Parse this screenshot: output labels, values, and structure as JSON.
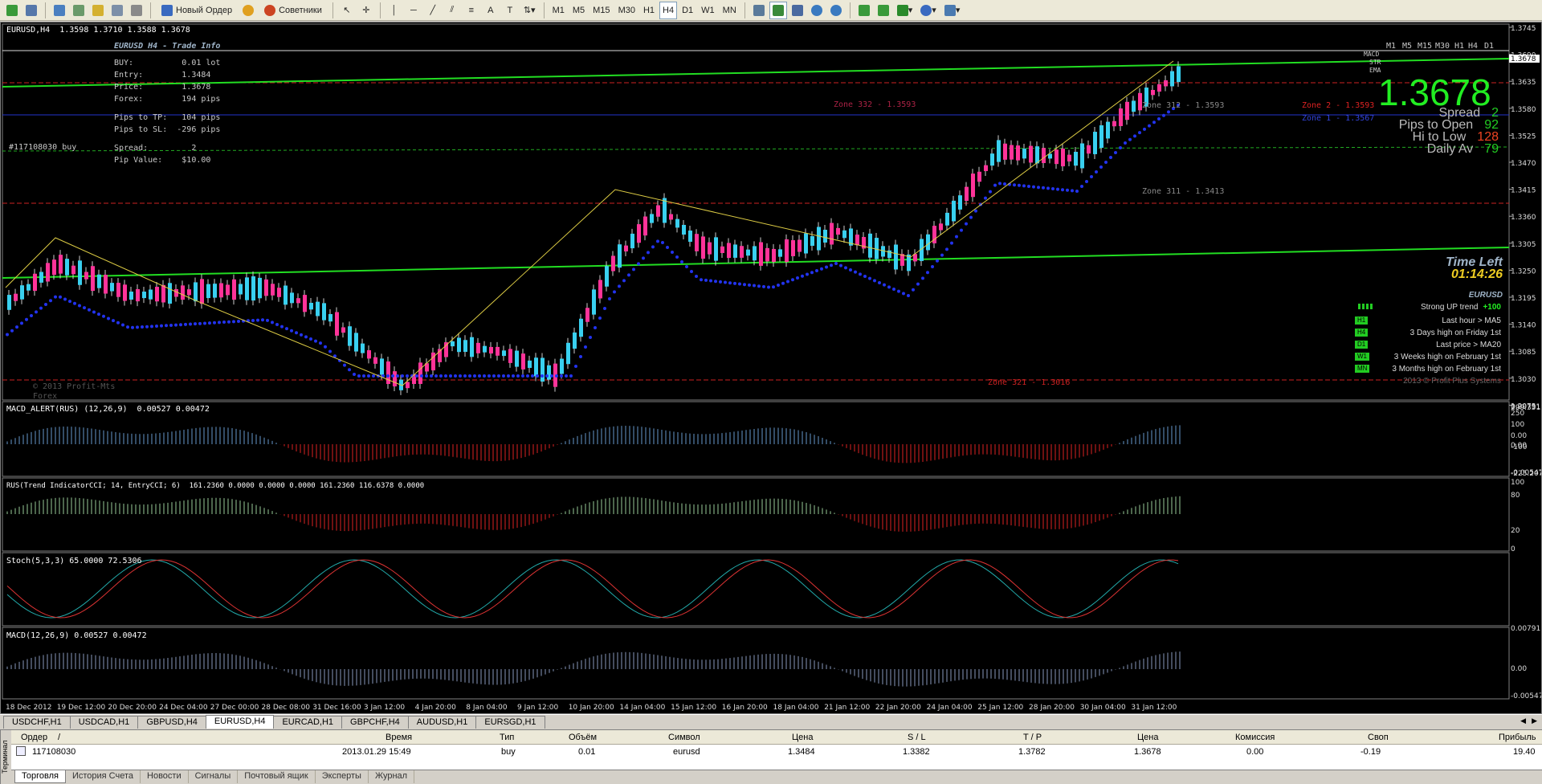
{
  "toolbar": {
    "new_order_label": "Новый Ордер",
    "advisors_label": "Советники",
    "timeframes": [
      "M1",
      "M5",
      "M15",
      "M30",
      "H1",
      "H4",
      "D1",
      "W1",
      "MN"
    ],
    "active_timeframe": "H4"
  },
  "chart": {
    "header": "EURUSD,H4  1.3598 1.3710 1.3588 1.3678",
    "order_label": "#117108030 buy",
    "watermark_1": "© 2013 Profit-Mts",
    "watermark_2": "Forex",
    "trade_info": {
      "title": "EURUSD H4 - Trade Info",
      "buy": "BUY:          0.01 lot",
      "entry": "Entry:        1.3484",
      "price": "Price:        1.3678",
      "forex": "Forex:        194 pips",
      "to_tp": "Pips to TP:   104 pips",
      "to_sl": "Pips to SL:  -296 pips",
      "spread": "Spread:         2",
      "pip_value": "Pip Value:    $10.00"
    },
    "zones": {
      "zone332": "Zone 332 - 1.3593",
      "zone312": "Zone 312 - 1.3593",
      "zone2": "Zone 2 - 1.3593",
      "zone1": "Zone 1 - 1.3567",
      "zone311": "Zone 311 - 1.3413",
      "zone321": "Zone 321 - 1.3016"
    },
    "price_axis": [
      "1.3745",
      "1.3690",
      "1.3635",
      "1.3580",
      "1.3525",
      "1.3470",
      "1.3415",
      "1.3360",
      "1.3305",
      "1.3250",
      "1.3195",
      "1.3140",
      "1.3085",
      "1.3030",
      "1.2975"
    ],
    "current_price_tag": "1.3678",
    "time_axis": [
      "18 Dec 2012",
      "19 Dec 12:00",
      "20 Dec 20:00",
      "24 Dec 04:00",
      "27 Dec 00:00",
      "28 Dec 08:00",
      "31 Dec 16:00",
      "3 Jan 12:00",
      "4 Jan 20:00",
      "8 Jan 04:00",
      "9 Jan 12:00",
      "10 Jan 20:00",
      "14 Jan 04:00",
      "15 Jan 12:00",
      "16 Jan 20:00",
      "18 Jan 04:00",
      "21 Jan 12:00",
      "22 Jan 20:00",
      "24 Jan 04:00",
      "25 Jan 12:00",
      "28 Jan 20:00",
      "30 Jan 04:00",
      "31 Jan 12:00"
    ]
  },
  "dashboard": {
    "tf_header": [
      "M1",
      "M5",
      "M15",
      "M30",
      "H1",
      "H4",
      "D1"
    ],
    "rows": [
      "MACD",
      "STR",
      "EMA"
    ],
    "big_price": "1.3678",
    "stats": [
      {
        "label": "Spread",
        "value": "2"
      },
      {
        "label": "Pips to Open",
        "value": "92"
      },
      {
        "label": "Hi to Low",
        "value": "128"
      },
      {
        "label": "Daily Av",
        "value": "79"
      }
    ],
    "time_left_label": "Time Left",
    "time_left_value": "01:14:26",
    "symbol": "EURUSD",
    "trend_label": "Strong UP trend",
    "trend_value": "+100",
    "signals": [
      {
        "tf": "H1",
        "text": "Last hour > MA5"
      },
      {
        "tf": "H4",
        "text": "3 Days high on Friday 1st"
      },
      {
        "tf": "D1",
        "text": "Last price > MA20"
      },
      {
        "tf": "W1",
        "text": "3 Weeks high on February 1st"
      },
      {
        "tf": "MN",
        "text": "3 Months high on February 1st"
      }
    ],
    "copyright": "2013 © Profit Plus Systems"
  },
  "subwindows": [
    {
      "title": "MACD_ALERT(RUS) (12,26,9)  0.00527 0.00472",
      "scale": [
        "0.00791",
        "0.00",
        "-0.00547"
      ]
    },
    {
      "title": "RUS(Trend IndicatorCCI; 14, EntryCCI; 6)  161.2360 0.0000 0.0000 0.0000 161.2360 116.6378 0.0000",
      "scale": [
        "299.3512",
        "250",
        "100",
        "0.00",
        "-100",
        "-225.207"
      ]
    },
    {
      "title": "Stoch(5,3,3) 65.0000 72.5306",
      "scale": [
        "100",
        "80",
        "20",
        "0"
      ]
    },
    {
      "title": "MACD(12,26,9) 0.00527 0.00472",
      "scale": [
        "0.00791",
        "0.00",
        "-0.00547"
      ]
    }
  ],
  "symbol_tabs": [
    "USDCHF,H1",
    "USDCAD,H1",
    "GBPUSD,H4",
    "EURUSD,H4",
    "EURCAD,H1",
    "GBPCHF,H4",
    "AUDUSD,H1",
    "EURSGD,H1"
  ],
  "active_symbol_tab": "EURUSD,H4",
  "terminal": {
    "side_label": "Терминал",
    "columns": [
      "Ордер",
      "/",
      "Время",
      "Тип",
      "Объём",
      "Символ",
      "Цена",
      "S / L",
      "T / P",
      "Цена",
      "Комиссия",
      "Своп",
      "Прибыль"
    ],
    "row": {
      "order": "117108030",
      "time": "2013.01.29 15:49",
      "type": "buy",
      "volume": "0.01",
      "symbol": "eurusd",
      "open_price": "1.3484",
      "sl": "1.3382",
      "tp": "1.3782",
      "price": "1.3678",
      "commission": "0.00",
      "swap": "-0.19",
      "profit": "19.40"
    },
    "tabs": [
      "Торговля",
      "История Счета",
      "Новости",
      "Сигналы",
      "Почтовый ящик",
      "Эксперты",
      "Журнал"
    ],
    "active_tab": "Торговля"
  }
}
